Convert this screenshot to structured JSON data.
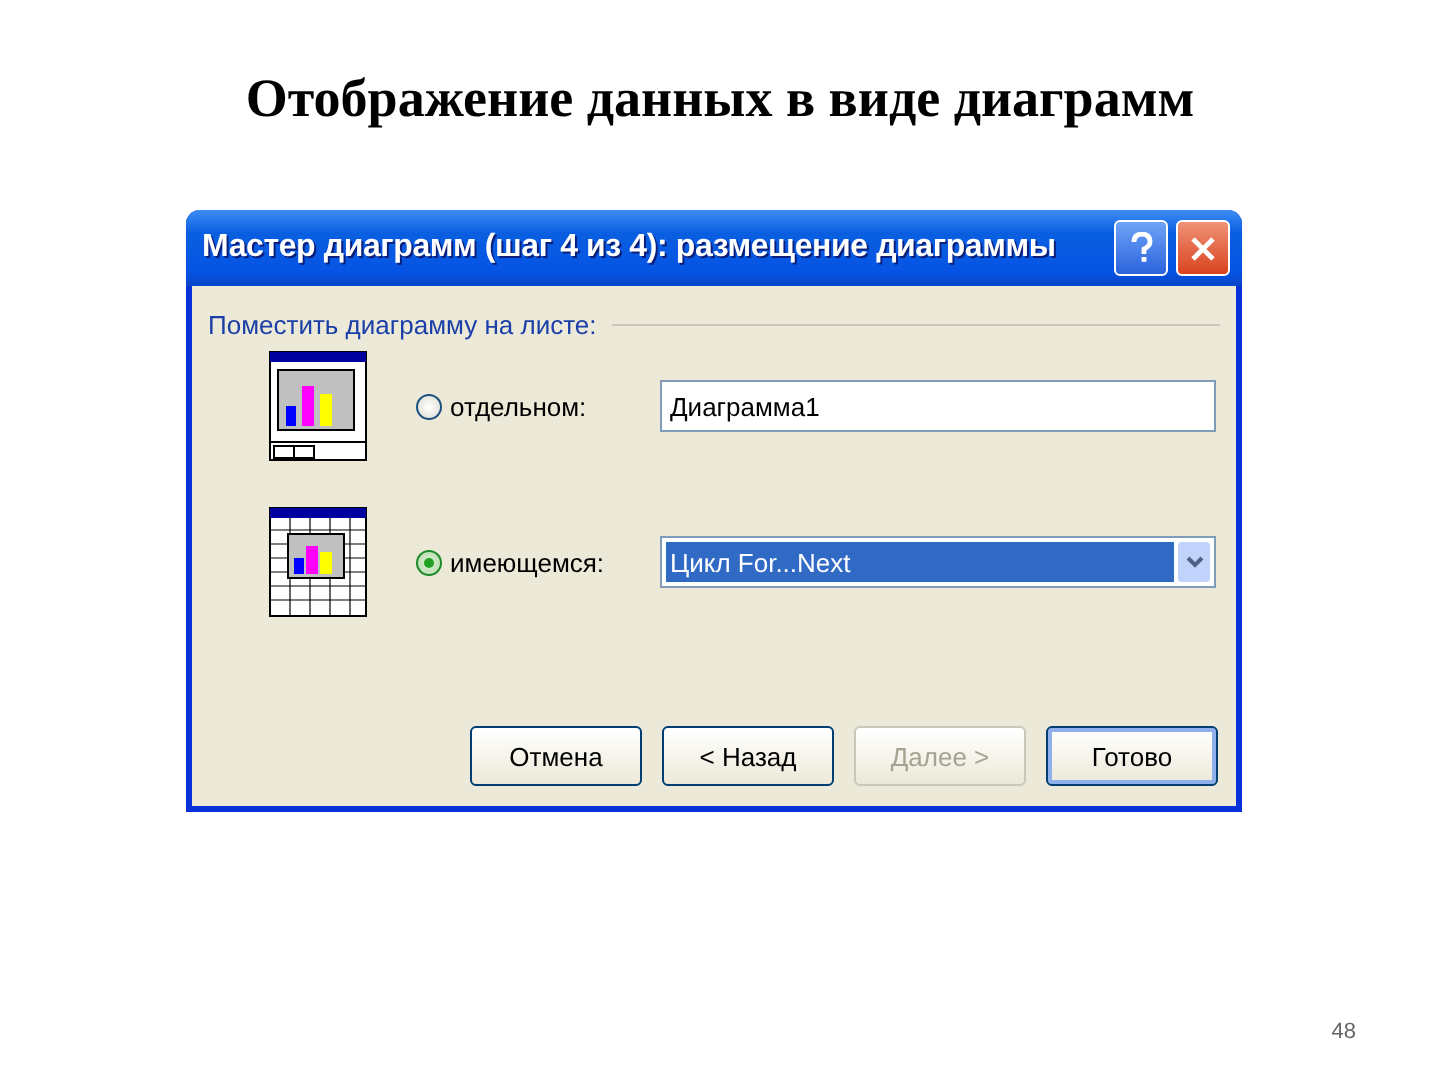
{
  "slide_title": "Отображение данных в виде диаграмм",
  "dialog": {
    "title": "Мастер диаграмм (шаг 4 из 4): размещение диаграммы",
    "group_label": "Поместить диаграмму на листе:",
    "options": [
      {
        "kind": "text",
        "label": "отдельном:",
        "selected": false,
        "value": "Диаграмма1"
      },
      {
        "kind": "combo",
        "label": "имеющемся:",
        "selected": true,
        "value": "Цикл For...Next"
      }
    ],
    "buttons": [
      {
        "label": "Отмена",
        "disabled": false,
        "default": false
      },
      {
        "label": "< Назад",
        "disabled": false,
        "default": false
      },
      {
        "label": "Далее >",
        "disabled": true,
        "default": false
      },
      {
        "label": "Готово",
        "disabled": false,
        "default": true
      }
    ]
  },
  "page_number": "48"
}
